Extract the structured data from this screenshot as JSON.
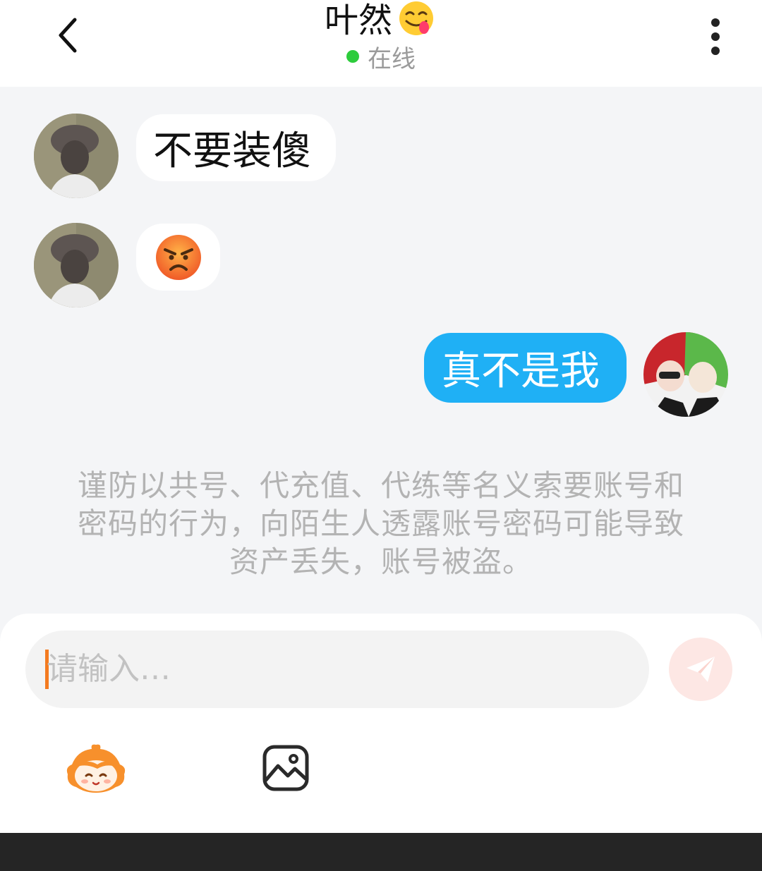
{
  "header": {
    "back_icon": "chevron-left-icon",
    "title": "叶然",
    "title_emoji": "face-savoring-food-emoji",
    "status": "在线",
    "status_color": "#2dcc3c",
    "more_icon": "vertical-dots-icon"
  },
  "messages": [
    {
      "side": "incoming",
      "type": "text",
      "text": "不要装傻",
      "avatar": "contact-avatar"
    },
    {
      "side": "incoming",
      "type": "emoji",
      "emoji": "angry-face-emoji",
      "avatar": "contact-avatar"
    },
    {
      "side": "outgoing",
      "type": "text",
      "text": "真不是我",
      "avatar": "self-avatar"
    }
  ],
  "notice": "谨防以共号、代充值、代练等名义索要账号和密码的行为，向陌生人透露账号密码可能导致资产丢失，账号被盗。",
  "composer": {
    "placeholder": "请输入…",
    "send_icon": "paper-plane-icon",
    "tools": [
      {
        "icon": "mascot-sticker-icon"
      },
      {
        "icon": "image-icon"
      }
    ]
  },
  "colors": {
    "outgoing_bubble": "#1fb0f5",
    "incoming_bubble": "#ffffff",
    "background": "#f4f5f7",
    "caret": "#f47b20",
    "send_button": "#fde7e4"
  }
}
